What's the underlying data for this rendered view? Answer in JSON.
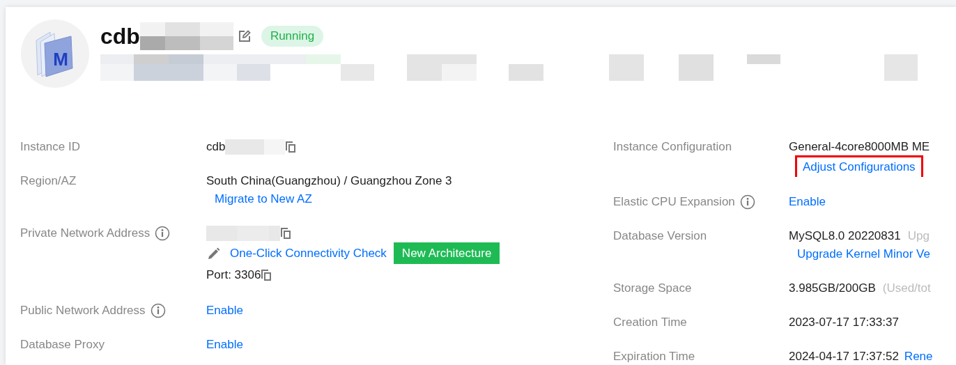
{
  "header": {
    "title": "cdb",
    "logo_letter": "M",
    "status": "Running"
  },
  "left_fields": [
    {
      "label": "Instance ID",
      "info": false,
      "lines": [
        [
          {
            "kind": "text",
            "text": "cdb"
          },
          {
            "kind": "mosaic"
          },
          {
            "kind": "copy"
          }
        ]
      ]
    },
    {
      "label": "Region/AZ",
      "info": false,
      "lines": [
        [
          {
            "kind": "text",
            "text": "South China(Guangzhou) / Guangzhou Zone 3"
          }
        ],
        [
          {
            "kind": "link",
            "text": "Migrate to New AZ"
          }
        ]
      ]
    },
    {
      "label": "Private Network Address",
      "info": true,
      "lines": [
        [
          {
            "kind": "mosaic"
          },
          {
            "kind": "copy"
          }
        ],
        [
          {
            "kind": "pencil"
          },
          {
            "kind": "link",
            "text": "One-Click Connectivity Check"
          },
          {
            "kind": "badge",
            "text": "New Architecture"
          }
        ],
        [
          {
            "kind": "text",
            "text": "Port: 3306"
          },
          {
            "kind": "copy"
          }
        ]
      ]
    },
    {
      "label": "Public Network Address",
      "info": true,
      "lines": [
        [
          {
            "kind": "link",
            "text": "Enable"
          }
        ]
      ]
    },
    {
      "label": "Database Proxy",
      "info": false,
      "lines": [
        [
          {
            "kind": "link",
            "text": "Enable"
          }
        ]
      ]
    }
  ],
  "right_fields": [
    {
      "label": "Instance Configuration",
      "info": false,
      "lines": [
        [
          {
            "kind": "text",
            "text": "General-4core8000MB ME"
          }
        ],
        [
          {
            "kind": "link",
            "text": "Adjust Configurations",
            "highlighted": true
          }
        ]
      ]
    },
    {
      "label": "Elastic CPU Expansion",
      "info": true,
      "lines": [
        [
          {
            "kind": "link",
            "text": "Enable"
          }
        ]
      ]
    },
    {
      "label": "Database Version",
      "info": false,
      "lines": [
        [
          {
            "kind": "text",
            "text": "MySQL8.0 20220831"
          },
          {
            "kind": "muted",
            "text": "Upg"
          }
        ],
        [
          {
            "kind": "link",
            "text": "Upgrade Kernel Minor Ve"
          }
        ]
      ]
    },
    {
      "label": "Storage Space",
      "info": false,
      "lines": [
        [
          {
            "kind": "text",
            "text": "3.985GB/200GB"
          },
          {
            "kind": "muted",
            "text": "(Used/tot"
          }
        ]
      ]
    },
    {
      "label": "Creation Time",
      "info": false,
      "lines": [
        [
          {
            "kind": "text",
            "text": "2023-07-17 17:33:37"
          }
        ]
      ]
    },
    {
      "label": "Expiration Time",
      "info": false,
      "lines": [
        [
          {
            "kind": "text",
            "text": "2024-04-17 17:37:52"
          },
          {
            "kind": "link",
            "text": "Rene"
          }
        ]
      ]
    }
  ]
}
